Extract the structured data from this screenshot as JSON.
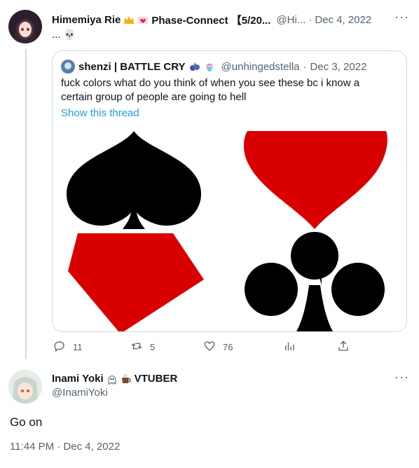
{
  "tweet": {
    "author_name": "Himemiya Rie",
    "author_name_suffix": "Phase-Connect 【5/20...",
    "author_handle": "@Hi...",
    "separator": "·",
    "date": "Dec 4, 2022",
    "text": "...",
    "emoji": "💀",
    "quote": {
      "author_name": "shenzi | BATTLE CRY",
      "author_handle": "@unhingedstella",
      "date": "Dec 3, 2022",
      "text": "fuck colors what do you think of when you see these bc i know a certain group of people are going to hell",
      "show_thread": "Show this thread"
    },
    "actions": {
      "replies": "11",
      "retweets": "5",
      "likes": "76"
    }
  },
  "reply": {
    "author_name": "Inami Yoki",
    "author_name_suffix": "VTUBER",
    "author_handle": "@InamiYoki",
    "text": "Go on",
    "timestamp": "11:44 PM · Dec 4, 2022"
  },
  "icons": {
    "more": "more-dots-icon",
    "reply": "reply-icon",
    "retweet": "retweet-icon",
    "like": "heart-icon",
    "stats": "stats-icon",
    "share": "share-icon"
  }
}
